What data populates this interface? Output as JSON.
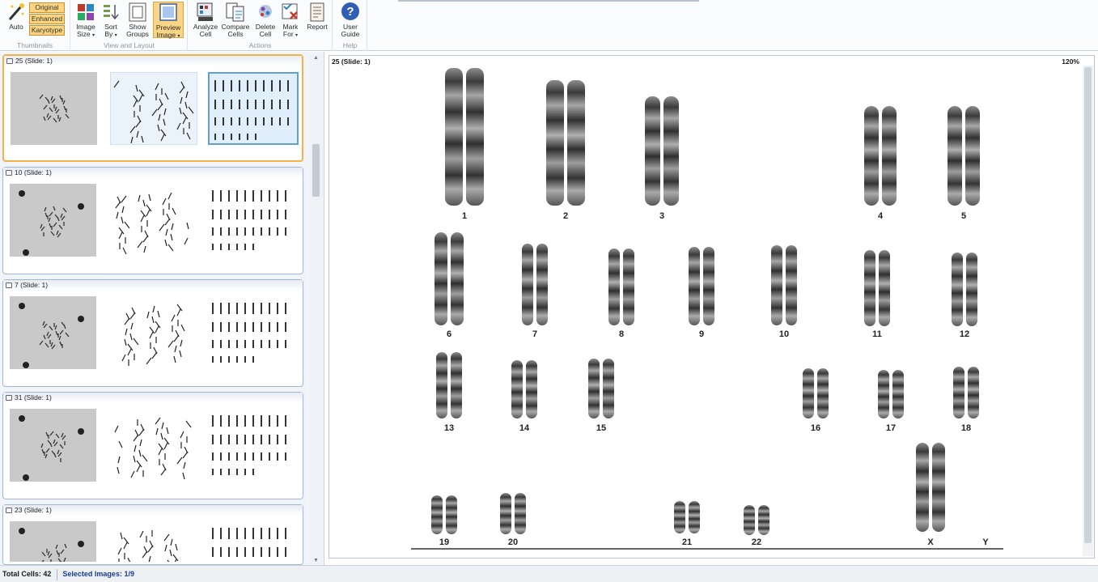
{
  "ribbon": {
    "groups": [
      {
        "title": "Thumbnails",
        "buttons": [
          {
            "label": "Auto",
            "icon": "auto-icon"
          }
        ],
        "display_modes": [
          "Original",
          "Enhanced",
          "Karyotype"
        ]
      },
      {
        "title": "View and Layout",
        "buttons": [
          {
            "label": "Image Size",
            "icon": "image-size-icon",
            "dropdown": true
          },
          {
            "label": "Sort By",
            "icon": "sort-icon",
            "dropdown": true
          },
          {
            "label": "Show Groups",
            "icon": "groups-icon"
          },
          {
            "label": "Preview Image",
            "icon": "preview-icon",
            "dropdown": true,
            "selected": true
          }
        ]
      },
      {
        "title": "Actions",
        "buttons": [
          {
            "label": "Analyze Cell",
            "icon": "analyze-icon"
          },
          {
            "label": "Compare Cells",
            "icon": "compare-icon"
          },
          {
            "label": "Delete Cell",
            "icon": "delete-icon"
          },
          {
            "label": "Mark For",
            "icon": "mark-icon",
            "dropdown": true
          },
          {
            "label": "Report",
            "icon": "report-icon"
          }
        ]
      },
      {
        "title": "Help",
        "buttons": [
          {
            "label": "User Guide",
            "icon": "help-icon"
          }
        ]
      }
    ]
  },
  "cells": [
    {
      "label": "25 (Slide: 1)",
      "active": true
    },
    {
      "label": "10 (Slide: 1)",
      "active": false
    },
    {
      "label": "7 (Slide: 1)",
      "active": false
    },
    {
      "label": "31 (Slide: 1)",
      "active": false
    },
    {
      "label": "23 (Slide: 1)",
      "active": false
    }
  ],
  "preview": {
    "title": "25 (Slide: 1)",
    "zoom": "120%",
    "chromosomes": [
      "1",
      "2",
      "3",
      "4",
      "5",
      "6",
      "7",
      "8",
      "9",
      "10",
      "11",
      "12",
      "13",
      "14",
      "15",
      "16",
      "17",
      "18",
      "19",
      "20",
      "21",
      "22",
      "X",
      "Y"
    ]
  },
  "status": {
    "total_label": "Total Cells:",
    "total_value": "42",
    "selected_label": "Selected Images:",
    "selected_value": "1/9"
  }
}
